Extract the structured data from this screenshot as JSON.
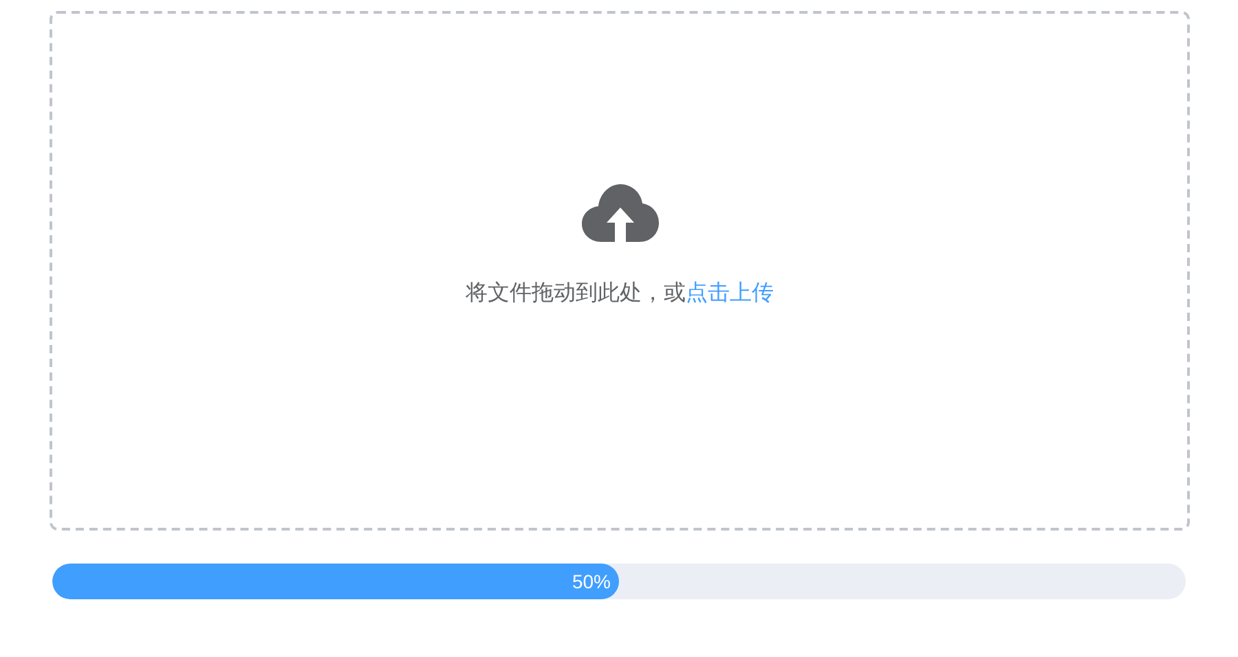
{
  "dropzone": {
    "text": "将文件拖动到此处，或",
    "link": "点击上传"
  },
  "progress": {
    "level": 0.5,
    "label": "50%"
  }
}
